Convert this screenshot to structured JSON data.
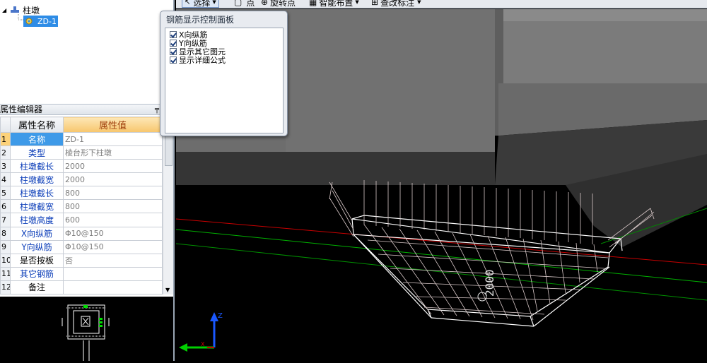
{
  "tree": {
    "root_label": "柱墩",
    "child_label": "ZD-1"
  },
  "toolbar": {
    "select_label": "选择",
    "point_label": "点",
    "rotate_point_label": "旋转点",
    "smart_layout_label": "智能布置",
    "find_dim_label": "查改标注"
  },
  "property_editor": {
    "title": "属性编辑器",
    "pin_glyph": "ᚕ",
    "col_name": "属性名称",
    "col_value": "属性值",
    "rows": [
      {
        "num": "1",
        "name": "名称",
        "value": "ZD-1"
      },
      {
        "num": "2",
        "name": "类型",
        "value": "棱台形下柱墩"
      },
      {
        "num": "3",
        "name": "柱墩截长",
        "value": "2000"
      },
      {
        "num": "4",
        "name": "柱墩截宽",
        "value": "2000"
      },
      {
        "num": "5",
        "name": "柱墩截长",
        "value": "800"
      },
      {
        "num": "6",
        "name": "柱墩截宽",
        "value": "800"
      },
      {
        "num": "7",
        "name": "柱墩高度",
        "value": "600"
      },
      {
        "num": "8",
        "name": "X向纵筋",
        "value": "Φ10@150"
      },
      {
        "num": "9",
        "name": "Y向纵筋",
        "value": "Φ10@150"
      },
      {
        "num": "10",
        "name": "是否按板",
        "value": "否"
      },
      {
        "num": "11",
        "name": "其它钢筋",
        "value": ""
      },
      {
        "num": "12",
        "name": "备注",
        "value": ""
      }
    ]
  },
  "rebar_panel": {
    "title": "钢筋显示控制面板",
    "options": [
      {
        "label": "X向纵筋",
        "checked": true
      },
      {
        "label": "Y向纵筋",
        "checked": true
      },
      {
        "label": "显示其它图元",
        "checked": true
      },
      {
        "label": "显示详细公式",
        "checked": true
      }
    ]
  },
  "view3d": {
    "dimension_label": "2000",
    "axis_z": "Z",
    "axis_x": "X",
    "colors": {
      "red_axis": "#d40000",
      "green_axis": "#00b400",
      "blue_axis": "#1a58ff"
    }
  }
}
